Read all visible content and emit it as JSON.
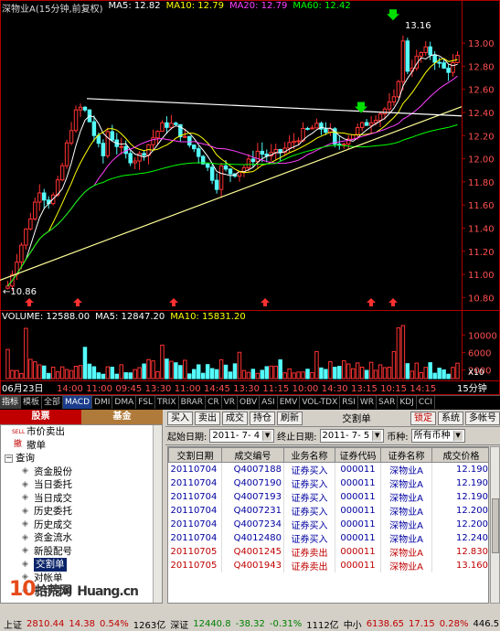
{
  "chart": {
    "ma_header": [
      {
        "text": "深物业A(15分钟,前复权)",
        "color": "#dddddd"
      },
      {
        "text": "MA5: 12.82",
        "color": "#ffffff"
      },
      {
        "text": "MA10: 12.79",
        "color": "#ffff00"
      },
      {
        "text": "MA20: 12.79",
        "color": "#ff40ff"
      },
      {
        "text": "MA60: 12.42",
        "color": "#00ff00"
      }
    ],
    "price_labels": [
      "13.00",
      "12.80",
      "12.60",
      "12.40",
      "12.20",
      "12.00",
      "11.80",
      "11.60",
      "11.40",
      "11.20",
      "11.00",
      "10.80"
    ],
    "high_label": "13.16",
    "low_label": "←10.86",
    "time_labels": [
      "06月23日",
      "14:00",
      "11:00",
      "09:45",
      "13:30",
      "11:00",
      "14:45",
      "13:30",
      "11:15",
      "10:00",
      "14:30",
      "13:15",
      "10:15",
      "14:15",
      "15分钟"
    ],
    "vol_header": [
      {
        "text": "VOLUME: 12588.00",
        "color": "#ffffff"
      },
      {
        "text": "MA5: 12847.20",
        "color": "#ffffff"
      },
      {
        "text": "MA10: 15831.20",
        "color": "#ffff00"
      }
    ],
    "vol_labels": [
      "10000",
      "6000",
      "2000"
    ],
    "vol_unit": "X10",
    "colors": {
      "up": "#ff3232",
      "down": "#54fcfc",
      "ma5": "#ffffff",
      "ma10": "#ffff00",
      "ma20": "#ff40ff",
      "ma60": "#00ff00",
      "axis": "#b00000"
    }
  },
  "indicators": [
    "指标",
    "模板",
    "全部",
    "MACD",
    "DMI",
    "DMA",
    "FSL",
    "TRIX",
    "BRAR",
    "CR",
    "VR",
    "OBV",
    "ASI",
    "EMV",
    "VOL-TDX",
    "RSI",
    "WR",
    "SAR",
    "KDJ",
    "CCI"
  ],
  "panel": {
    "tabs": {
      "stock": "股票",
      "fund": "基金"
    },
    "tree": [
      {
        "icon": "SELL",
        "label": "市价卖出",
        "level": 1
      },
      {
        "icon": "撤",
        "label": "撤单",
        "level": 1
      },
      {
        "icon": "−",
        "label": "查询",
        "level": 0
      },
      {
        "icon": "◈",
        "label": "资金股份",
        "level": 2
      },
      {
        "icon": "◈",
        "label": "当日委托",
        "level": 2
      },
      {
        "icon": "◈",
        "label": "当日成交",
        "level": 2
      },
      {
        "icon": "◈",
        "label": "历史委托",
        "level": 2
      },
      {
        "icon": "◈",
        "label": "历史成交",
        "level": 2
      },
      {
        "icon": "◈",
        "label": "资金流水",
        "level": 2
      },
      {
        "icon": "◈",
        "label": "新股配号",
        "level": 2
      },
      {
        "icon": "◈",
        "label": "交割单",
        "level": 2,
        "selected": true
      },
      {
        "icon": "◈",
        "label": "对帐单",
        "level": 2
      },
      {
        "icon": "◈",
        "label": "打印交割",
        "level": 2
      }
    ],
    "toolbar": {
      "buttons": [
        "买入",
        "卖出",
        "成交",
        "持仓",
        "刷新"
      ],
      "title": "交割单",
      "right_buttons": [
        "锁定",
        "系统",
        "多帐号"
      ]
    },
    "filter": {
      "start_label": "起始日期:",
      "start_value": "2011- 7- 4",
      "end_label": "终止日期:",
      "end_value": "2011- 7- 5",
      "currency_label": "币种:",
      "currency_value": "所有币种"
    },
    "grid": {
      "columns": [
        "交割日期",
        "成交编号",
        "业务名称",
        "证券代码",
        "证券名称",
        "成交价格"
      ],
      "rows": [
        {
          "date": "20110704",
          "no": "Q4007188",
          "biz": "证券买入",
          "code": "000011",
          "name": "深物业A",
          "price": "12.190",
          "sell": false
        },
        {
          "date": "20110704",
          "no": "Q4007190",
          "biz": "证券买入",
          "code": "000011",
          "name": "深物业A",
          "price": "12.190",
          "sell": false
        },
        {
          "date": "20110704",
          "no": "Q4007193",
          "biz": "证券买入",
          "code": "000011",
          "name": "深物业A",
          "price": "12.190",
          "sell": false
        },
        {
          "date": "20110704",
          "no": "Q4007231",
          "biz": "证券买入",
          "code": "000011",
          "name": "深物业A",
          "price": "12.200",
          "sell": false
        },
        {
          "date": "20110704",
          "no": "Q4007234",
          "biz": "证券买入",
          "code": "000011",
          "name": "深物业A",
          "price": "12.200",
          "sell": false
        },
        {
          "date": "20110704",
          "no": "Q4012480",
          "biz": "证券买入",
          "code": "000011",
          "name": "深物业A",
          "price": "12.240",
          "sell": false
        },
        {
          "date": "20110705",
          "no": "Q4001245",
          "biz": "证券卖出",
          "code": "000011",
          "name": "深物业A",
          "price": "12.830",
          "sell": true
        },
        {
          "date": "20110705",
          "no": "Q4001943",
          "biz": "证券卖出",
          "code": "000011",
          "name": "深物业A",
          "price": "13.160",
          "sell": true
        }
      ]
    }
  },
  "status": {
    "sh_label": "上证",
    "sh_value": "2810.44",
    "sh_change": "14.38",
    "sh_pct": "0.54%",
    "sh_amount": "1263亿",
    "sz_label": "深证",
    "sz_value": "12440.8",
    "sz_change": "-38.32",
    "sz_pct": "-0.31%",
    "sz_amount": "1112亿",
    "zx_label": "中小",
    "zx_value": "6138.65",
    "zx_change": "17.15",
    "zx_pct": "0.28%",
    "zx_amount": "446.5"
  },
  "watermark": {
    "brand": "10",
    "site": "拾荒网",
    "domain": "Huang.cn"
  }
}
